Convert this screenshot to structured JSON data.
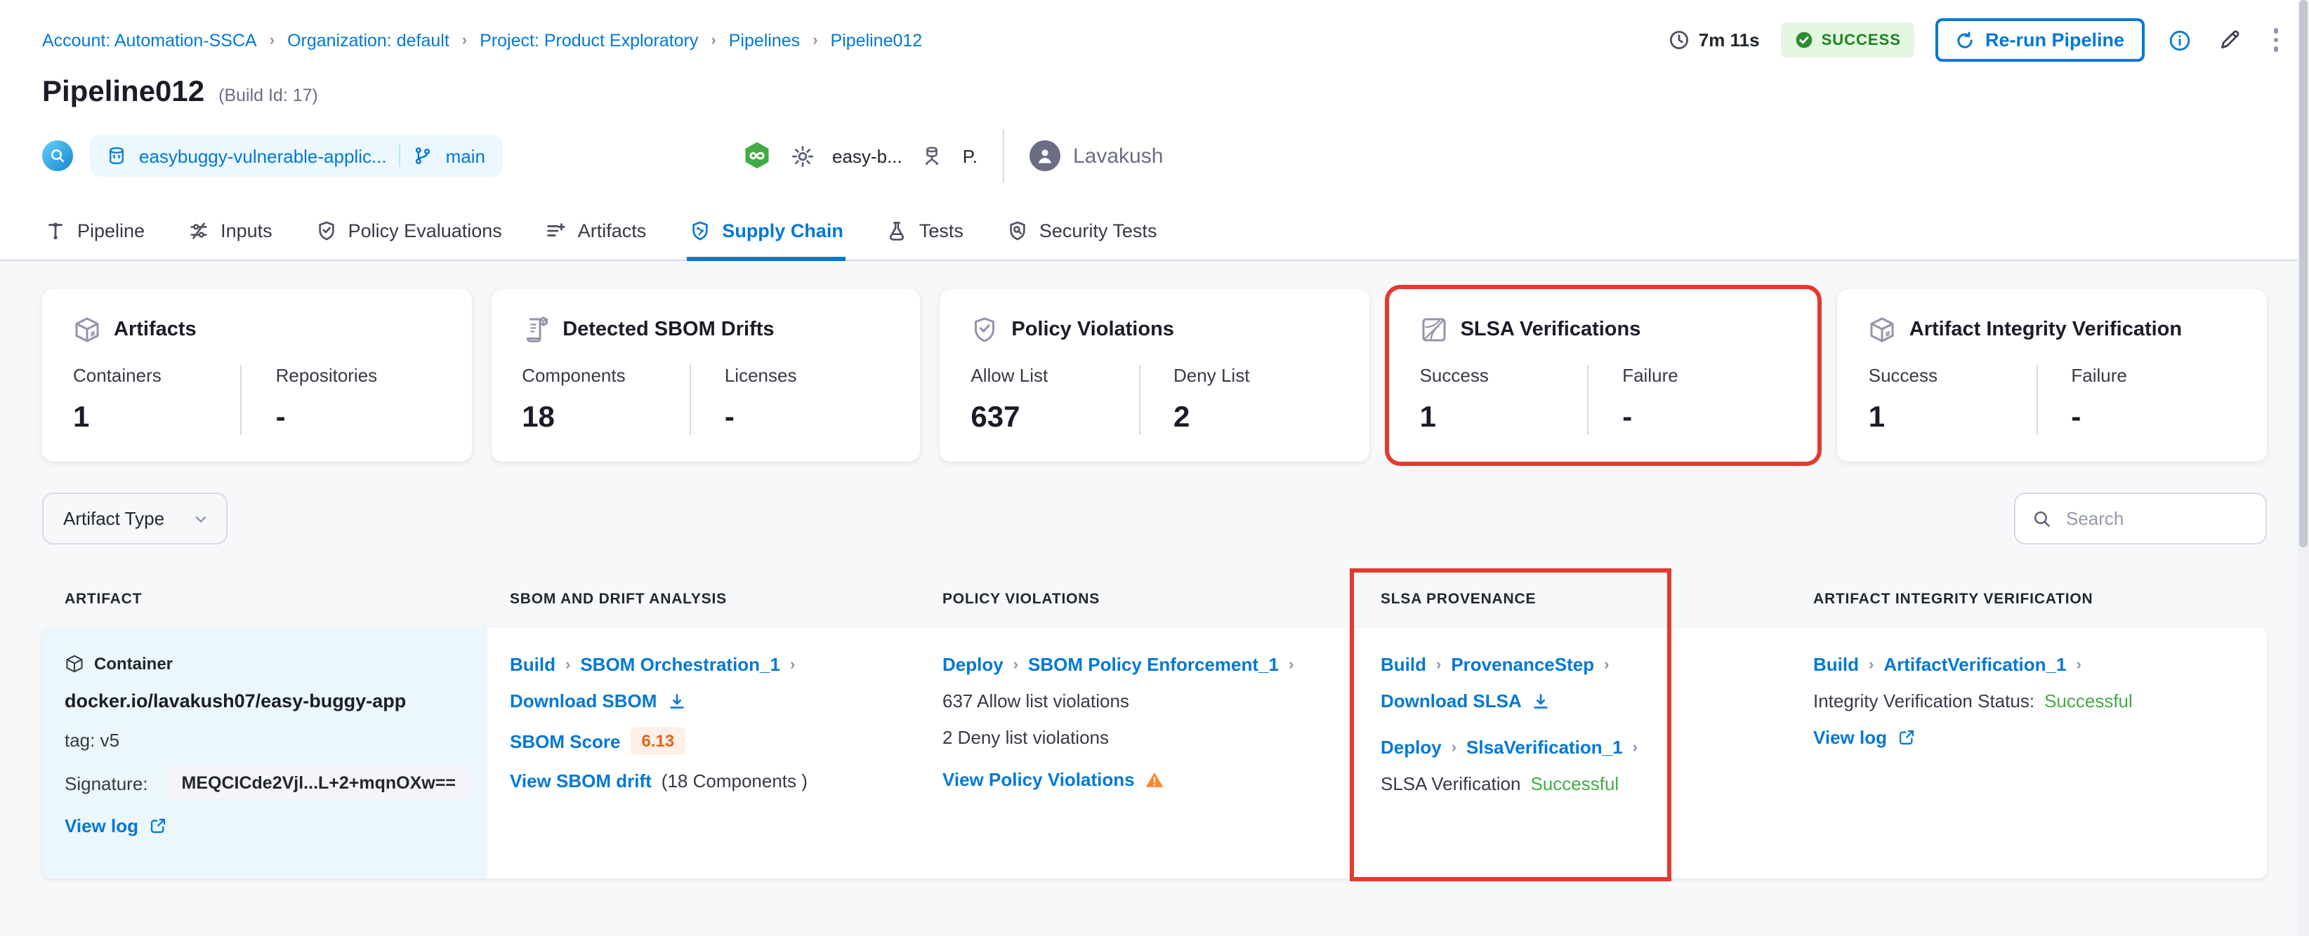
{
  "breadcrumb": {
    "items": [
      "Account: Automation-SSCA",
      "Organization: default",
      "Project: Product Exploratory",
      "Pipelines",
      "Pipeline012"
    ]
  },
  "header": {
    "title": "Pipeline012",
    "build_id": "(Build Id: 17)",
    "duration": "7m 11s",
    "status_label": "SUCCESS",
    "rerun_label": "Re-run Pipeline",
    "repo_name": "easybuggy-vulnerable-applic...",
    "branch_name": "main",
    "trigger_name": "easy-b...",
    "trigger_initial": "P.",
    "user_name": "Lavakush"
  },
  "tabs": [
    {
      "label": "Pipeline",
      "active": false
    },
    {
      "label": "Inputs",
      "active": false
    },
    {
      "label": "Policy Evaluations",
      "active": false
    },
    {
      "label": "Artifacts",
      "active": false
    },
    {
      "label": "Supply Chain",
      "active": true
    },
    {
      "label": "Tests",
      "active": false
    },
    {
      "label": "Security Tests",
      "active": false
    }
  ],
  "summary_cards": [
    {
      "title": "Artifacts",
      "highlighted": false,
      "stats": [
        {
          "label": "Containers",
          "value": "1"
        },
        {
          "label": "Repositories",
          "value": "-"
        }
      ]
    },
    {
      "title": "Detected SBOM Drifts",
      "highlighted": false,
      "stats": [
        {
          "label": "Components",
          "value": "18"
        },
        {
          "label": "Licenses",
          "value": "-"
        }
      ]
    },
    {
      "title": "Policy Violations",
      "highlighted": false,
      "stats": [
        {
          "label": "Allow List",
          "value": "637"
        },
        {
          "label": "Deny List",
          "value": "2"
        }
      ]
    },
    {
      "title": "SLSA Verifications",
      "highlighted": true,
      "stats": [
        {
          "label": "Success",
          "value": "1"
        },
        {
          "label": "Failure",
          "value": "-"
        }
      ]
    },
    {
      "title": "Artifact Integrity Verification",
      "highlighted": false,
      "stats": [
        {
          "label": "Success",
          "value": "1"
        },
        {
          "label": "Failure",
          "value": "-"
        }
      ]
    }
  ],
  "filters": {
    "artifact_type_label": "Artifact Type",
    "search_placeholder": "Search"
  },
  "table": {
    "headers": [
      "ARTIFACT",
      "SBOM AND DRIFT ANALYSIS",
      "POLICY VIOLATIONS",
      "SLSA PROVENANCE",
      "ARTIFACT INTEGRITY VERIFICATION"
    ],
    "row": {
      "artifact": {
        "type_label": "Container",
        "name": "docker.io/lavakush07/easy-buggy-app",
        "tag": "tag: v5",
        "signature_label": "Signature:",
        "signature_value": "MEQCICde2Vjl...L+2+mqnOXw==",
        "view_log_label": "View log"
      },
      "sbom": {
        "stage": "Build",
        "step": "SBOM Orchestration_1",
        "download_label": "Download SBOM",
        "score_label": "SBOM Score",
        "score_value": "6.13",
        "drift_label": "View SBOM drift",
        "drift_count": "(18 Components )"
      },
      "policy": {
        "stage": "Deploy",
        "step": "SBOM Policy Enforcement_1",
        "allow_text": "637 Allow list violations",
        "deny_text": "2 Deny list violations",
        "view_label": "View Policy Violations"
      },
      "slsa": {
        "stage1": "Build",
        "step1": "ProvenanceStep",
        "download_label": "Download SLSA",
        "stage2": "Deploy",
        "step2": "SlsaVerification_1",
        "status_label": "SLSA Verification",
        "status_value": "Successful"
      },
      "integrity": {
        "stage": "Build",
        "step": "ArtifactVerification_1",
        "status_label": "Integrity Verification Status:",
        "status_value": "Successful",
        "view_log_label": "View log"
      }
    }
  },
  "colors": {
    "accent": "#0278d5",
    "success-green": "#42ab45",
    "badge-green-bg": "#e4f7e1",
    "badge-green-text": "#1b841d",
    "highlight-red": "#e5392e",
    "score-orange": "#e2651f",
    "warning-orange": "#ff832b"
  }
}
